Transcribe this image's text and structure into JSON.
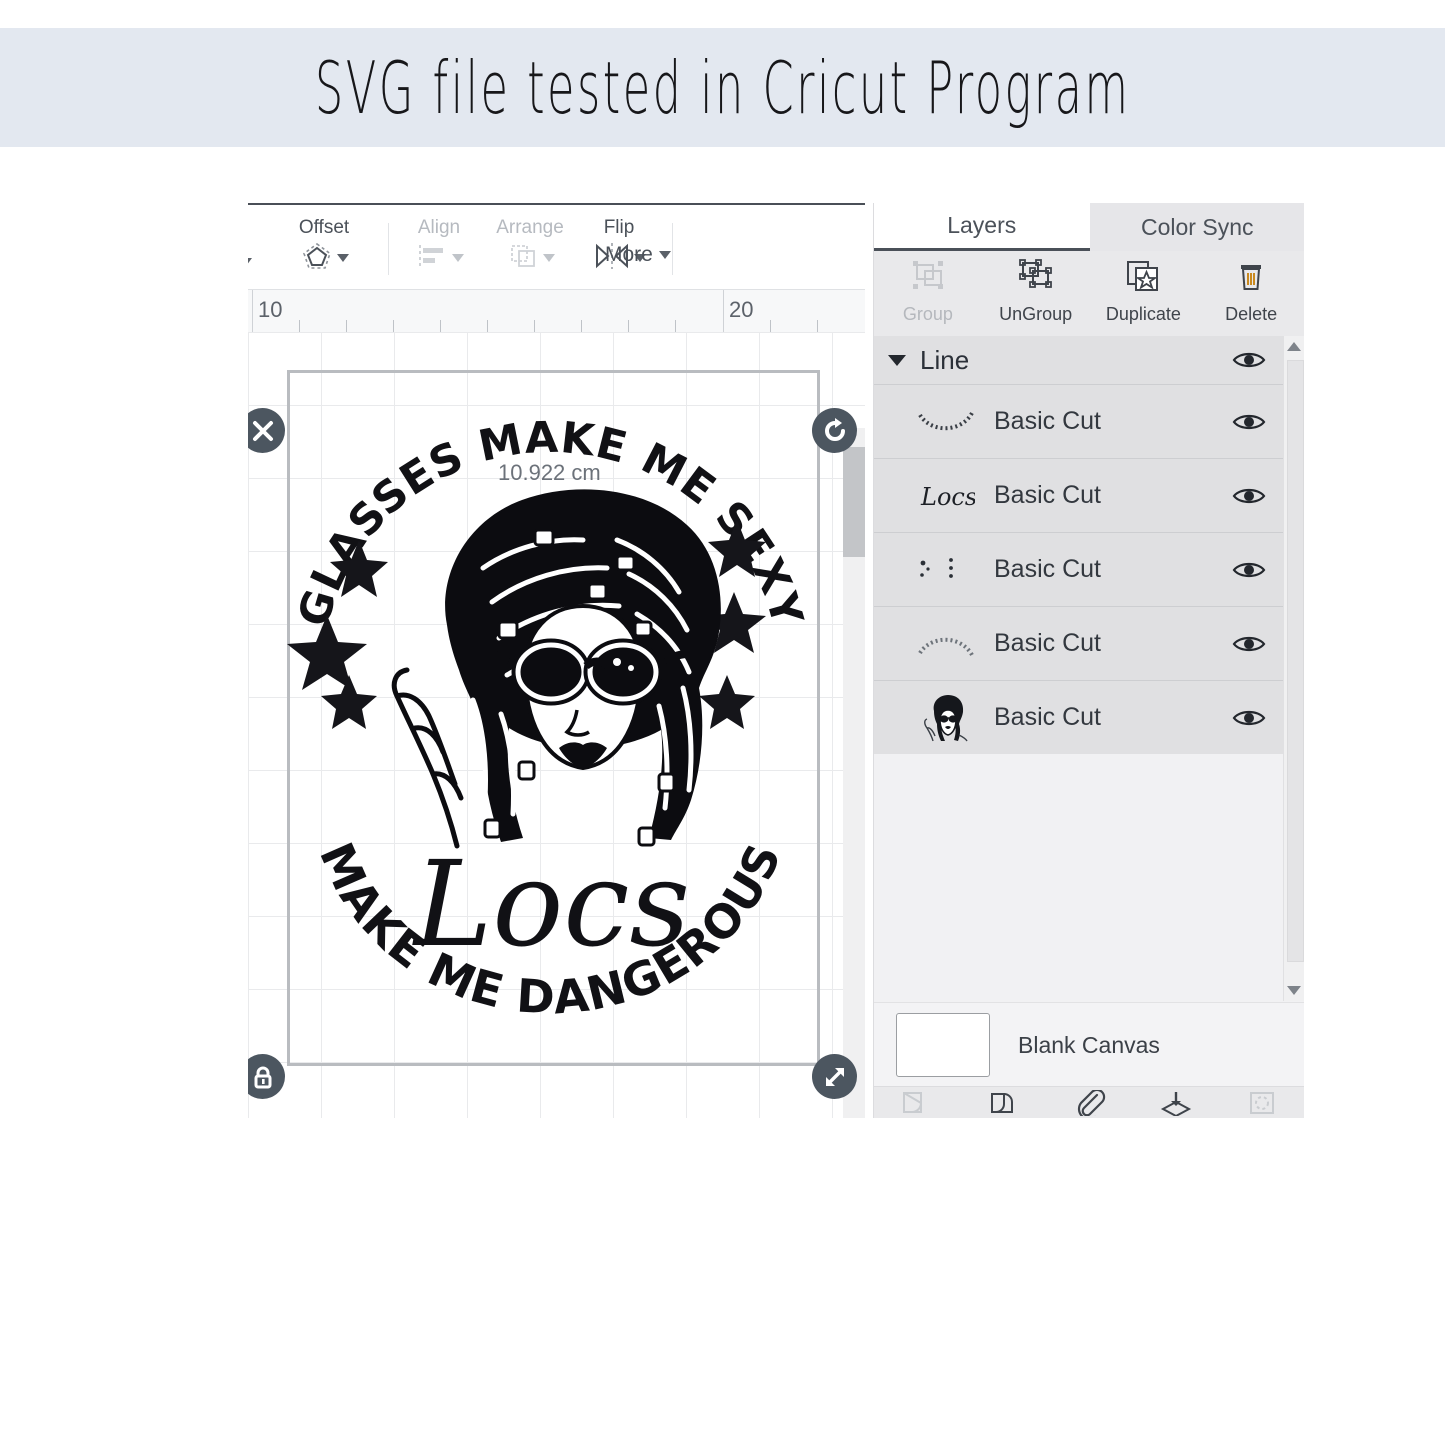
{
  "banner": {
    "text": "SVG file tested in Cricut Program",
    "bg": "#e3e8f0"
  },
  "toolbar": {
    "items": [
      {
        "label": "Offset",
        "icon": "offset-icon",
        "disabled": false
      },
      {
        "label": "Align",
        "icon": "align-icon",
        "disabled": true
      },
      {
        "label": "Arrange",
        "icon": "arrange-icon",
        "disabled": true
      },
      {
        "label": "Flip",
        "icon": "flip-icon",
        "disabled": false
      }
    ],
    "more_label": "More"
  },
  "ruler": {
    "marks": [
      "10",
      "20"
    ]
  },
  "canvas": {
    "dimension_label": "10.922 cm",
    "handles": [
      {
        "name": "delete-handle",
        "icon": "x-icon"
      },
      {
        "name": "rotate-handle",
        "icon": "rotate-icon"
      },
      {
        "name": "lock-handle",
        "icon": "lock-icon"
      },
      {
        "name": "resize-handle",
        "icon": "resize-icon"
      }
    ],
    "artwork": {
      "top_arc_text": "GLASSES MAKE ME SEXY",
      "script_text": "Locs",
      "bottom_arc_text": "MAKE ME DANGEROUS"
    }
  },
  "panel": {
    "tabs": [
      {
        "label": "Layers",
        "active": true
      },
      {
        "label": "Color Sync",
        "active": false
      }
    ],
    "actions": [
      {
        "label": "Group",
        "icon": "group-icon",
        "disabled": true
      },
      {
        "label": "UnGroup",
        "icon": "ungroup-icon",
        "disabled": false
      },
      {
        "label": "Duplicate",
        "icon": "duplicate-icon",
        "disabled": false
      },
      {
        "label": "Delete",
        "icon": "trash-icon",
        "disabled": false
      }
    ],
    "group": {
      "name": "Line",
      "expanded": true
    },
    "layers": [
      {
        "name": "Basic Cut",
        "thumb": "arc-text-thumb",
        "visible": true
      },
      {
        "name": "Basic Cut",
        "thumb": "locs-script-thumb",
        "visible": true
      },
      {
        "name": "Basic Cut",
        "thumb": "stars-thumb",
        "visible": true
      },
      {
        "name": "Basic Cut",
        "thumb": "arc-text-top-thumb",
        "visible": true
      },
      {
        "name": "Basic Cut",
        "thumb": "woman-portrait-thumb",
        "visible": true
      }
    ],
    "canvas_row": {
      "label": "Blank Canvas",
      "swatch": "#ffffff"
    },
    "bottom_tools": [
      {
        "name": "slice-icon",
        "disabled": true
      },
      {
        "name": "weld-icon",
        "disabled": false
      },
      {
        "name": "attach-icon",
        "disabled": false
      },
      {
        "name": "flatten-icon",
        "disabled": false
      },
      {
        "name": "contour-icon",
        "disabled": true
      }
    ]
  }
}
